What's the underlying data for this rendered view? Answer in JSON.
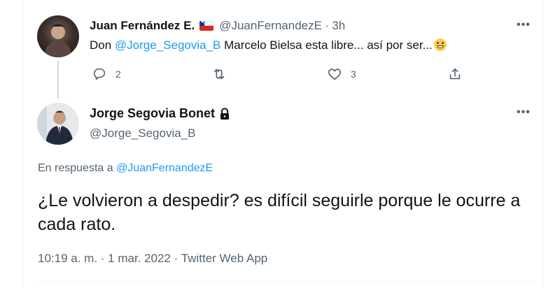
{
  "tweet1": {
    "author_name": "Juan Fernández E.",
    "flag": "chile-flag",
    "handle": "@JuanFernandezE",
    "time": "· 3h",
    "text_prefix": "Don ",
    "mention": "@Jorge_Segovia_B",
    "text_suffix": " Marcelo Bielsa esta libre... así por ser...",
    "emoji": "grinning-face-icon",
    "replies": "2",
    "retweets": "",
    "likes": "3",
    "more": "•••"
  },
  "tweet2": {
    "author_name": "Jorge Segovia Bonet",
    "handle": "@Jorge_Segovia_B",
    "reply_prefix": "En respuesta a ",
    "reply_to": "@JuanFernandezE",
    "text": "¿Le volvieron a despedir? es difícil seguirle porque le ocurre a cada rato.",
    "time": "10:19 a. m.",
    "separator1": " · ",
    "date": "1 mar. 2022",
    "separator2": " · ",
    "source": "Twitter Web App",
    "more": "•••"
  },
  "colors": {
    "accent": "#1d9bf0",
    "text": "#0f1419",
    "muted": "#536471",
    "thread_line": "#cfd9de"
  }
}
